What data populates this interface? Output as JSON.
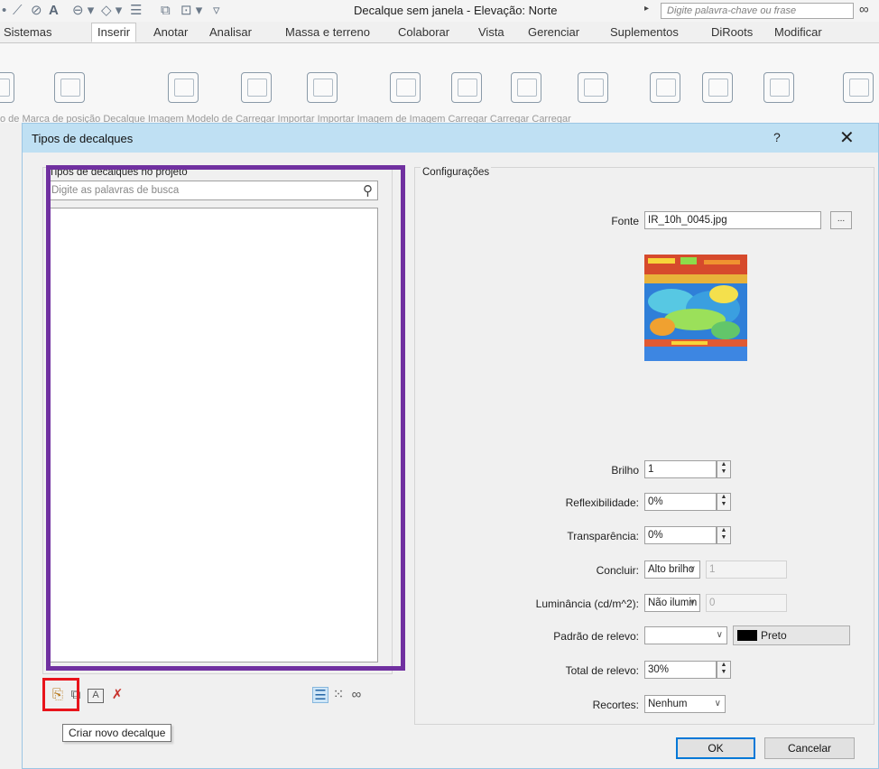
{
  "app": {
    "document_title": "Decalque sem janela - Elevação: Norte",
    "search_placeholder": "Digite palavra-chave ou frase"
  },
  "ribbon": {
    "tabs": [
      "Sistemas",
      "Inserir",
      "Anotar",
      "Analisar",
      "Massa e terreno",
      "Colaborar",
      "Vista",
      "Gerenciar",
      "Suplementos",
      "DiRoots",
      "Modificar"
    ],
    "active_tab": "Inserir",
    "button_labels_partial": "o de  Marca de posição  Decalque  Imagem  Modelo de  Carregar  Importar  Importar  Imagem de  Imagem  Carregar  Carregar  Carregar"
  },
  "dialog": {
    "title": "Tipos de decalques",
    "help_label": "?",
    "close_label": "✕",
    "left": {
      "caption": "Tipos de decalques no projeto",
      "search_placeholder": "Digite as palavras de busca",
      "items": []
    },
    "toolbar": {
      "tooltip": "Criar novo decalque",
      "icons": [
        "new-decal-icon",
        "duplicate-icon",
        "rename-icon",
        "delete-icon",
        "list-view-icon",
        "small-icons-view-icon",
        "large-icons-view-icon"
      ]
    },
    "settings": {
      "caption": "Configurações",
      "source_label": "Fonte",
      "source_value": "IR_10h_0045.jpg",
      "browse_label": "...",
      "brightness_label": "Brilho",
      "brightness_value": "1",
      "reflectivity_label": "Reflexibilidade:",
      "reflectivity_value": "0%",
      "transparency_label": "Transparência:",
      "transparency_value": "0%",
      "finish_label": "Concluir:",
      "finish_value": "Alto brilho",
      "finish_number": "1",
      "luminance_label": "Luminância (cd/m^2):",
      "luminance_value": "Não ilumin",
      "luminance_number": "0",
      "bump_pattern_label": "Padrão de relevo:",
      "bump_pattern_value": "",
      "bump_color_name": "Preto",
      "bump_amount_label": "Total de relevo:",
      "bump_amount_value": "30%",
      "cutouts_label": "Recortes:",
      "cutouts_value": "Nenhum"
    },
    "ok_label": "OK",
    "cancel_label": "Cancelar"
  },
  "colors": {
    "highlight_frame_purple": "#7030a0",
    "highlight_frame_red": "#e8141b",
    "dialog_titlebar": "#bfe0f3"
  }
}
